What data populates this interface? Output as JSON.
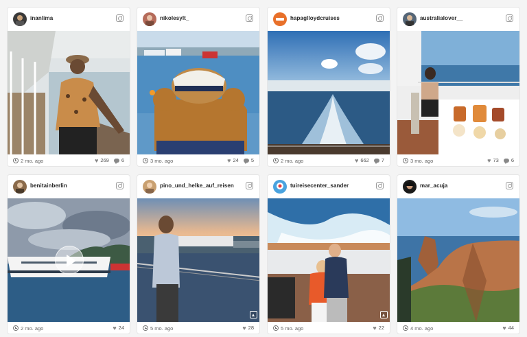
{
  "posts": [
    {
      "username": "inanlima",
      "time": "2 mo. ago",
      "likes": "269",
      "comments": "6"
    },
    {
      "username": "nikolesylt_",
      "time": "3 mo. ago",
      "likes": "24",
      "comments": "5"
    },
    {
      "username": "hapaglloydcruises",
      "time": "2 mo. ago",
      "likes": "662",
      "comments": "7"
    },
    {
      "username": "australialover__",
      "time": "3 mo. ago",
      "likes": "73",
      "comments": "6"
    },
    {
      "username": "benitainberlin",
      "time": "2 mo. ago",
      "likes": "24",
      "comments": ""
    },
    {
      "username": "pino_und_helke_auf_reisen",
      "time": "5 mo. ago",
      "likes": "28",
      "comments": ""
    },
    {
      "username": "tuireisecenter_sander",
      "time": "5 mo. ago",
      "likes": "22",
      "comments": ""
    },
    {
      "username": "mar_acuja",
      "time": "4 mo. ago",
      "likes": "44",
      "comments": ""
    }
  ],
  "icons": {
    "instagram": "instagram-icon",
    "clock": "clock-icon",
    "heart": "heart-icon",
    "comment": "comment-icon",
    "play": "play-icon",
    "gallery": "gallery-icon"
  },
  "colors": {
    "background": "#f4f4f4",
    "card": "#ffffff",
    "meta_text": "#666666"
  }
}
